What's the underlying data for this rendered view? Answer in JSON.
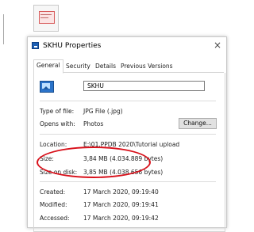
{
  "dialog": {
    "title": "SKHU Properties",
    "close_glyph": "×",
    "title_icon": "properties-icon"
  },
  "tabs": [
    {
      "label": "General",
      "active": true
    },
    {
      "label": "Security",
      "active": false
    },
    {
      "label": "Details",
      "active": false
    },
    {
      "label": "Previous Versions",
      "active": false
    }
  ],
  "general": {
    "file_name": "SKHU",
    "file_icon": "image-file-icon",
    "type_label": "Type of file:",
    "type_value": "JPG File (.jpg)",
    "opens_label": "Opens with:",
    "opens_value": "Photos",
    "change_button": "Change...",
    "location_label": "Location:",
    "location_value": "E:\\01.PPDB 2020\\Tutorial upload",
    "size_label": "Size:",
    "size_value": "3,84 MB (4.034.889 bytes)",
    "size_on_disk_label": "Size on disk:",
    "size_on_disk_value": "3,85 MB (4.038.656 bytes)",
    "created_label": "Created:",
    "created_value": "17 March 2020, 09:19:40",
    "modified_label": "Modified:",
    "modified_value": "17 March 2020, 09:19:41",
    "accessed_label": "Accessed:",
    "accessed_value": "17 March 2020, 09:19:42"
  },
  "colors": {
    "highlight_ellipse": "#d8101a"
  }
}
